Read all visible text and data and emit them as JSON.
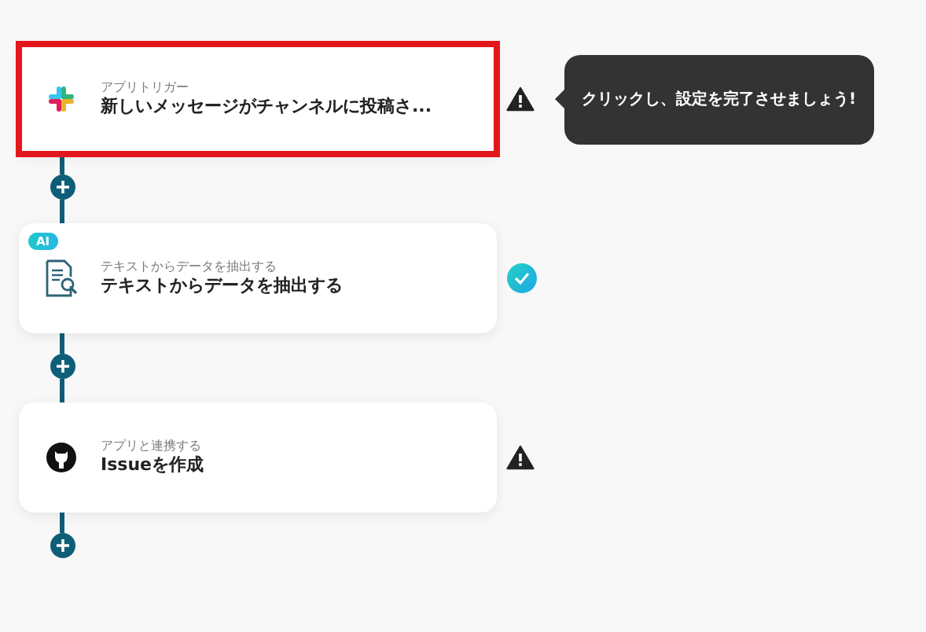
{
  "steps": [
    {
      "kind": "slack",
      "caption": "アプリトリガー",
      "title": "新しいメッセージがチャンネルに投稿さ...",
      "highlighted": true,
      "warning": true,
      "completed": false,
      "tooltip": "クリックし、設定を完了させましょう!"
    },
    {
      "kind": "ai",
      "badge": "AI",
      "caption": "テキストからデータを抽出する",
      "title": "テキストからデータを抽出する",
      "highlighted": false,
      "warning": false,
      "completed": true
    },
    {
      "kind": "github",
      "caption": "アプリと連携する",
      "title": "Issueを作成",
      "highlighted": false,
      "warning": true,
      "completed": false
    }
  ]
}
